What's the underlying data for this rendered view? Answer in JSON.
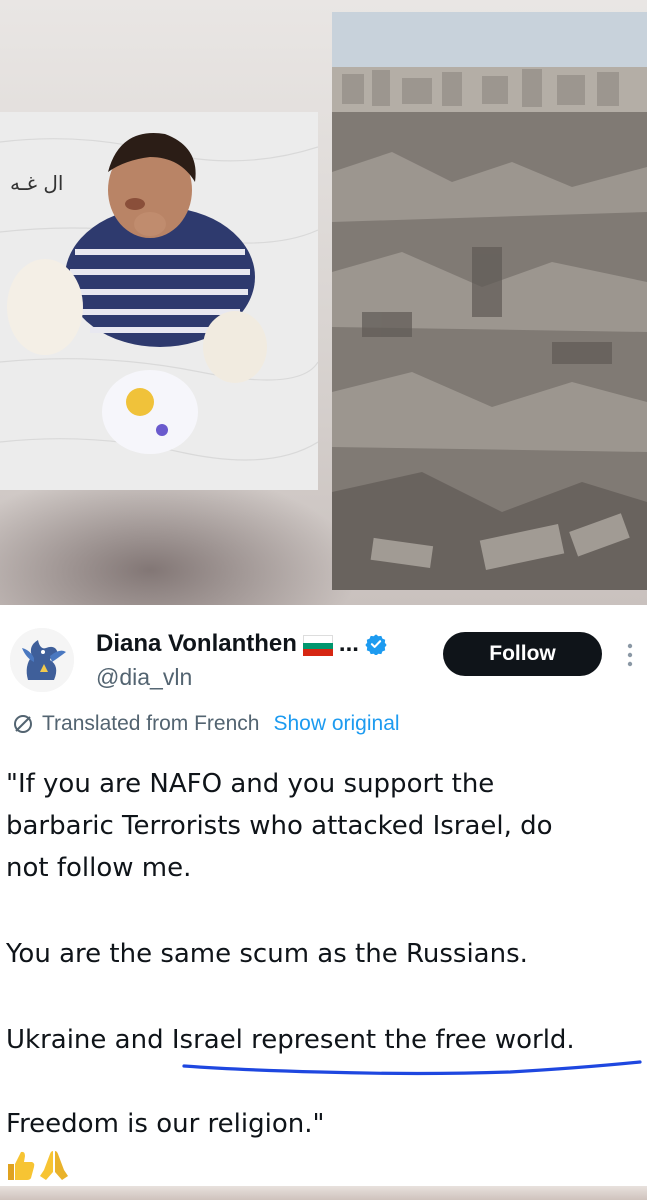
{
  "images": {
    "left_photo": "child-patient-photo",
    "right_photo": "rubble-landscape-photo",
    "left_photo_caption": "ال غـه"
  },
  "tweet": {
    "display_name": "Diana Vonlanthen",
    "name_suffix": "...",
    "handle": "@dia_vln",
    "follow_label": "Follow",
    "translated_label": "Translated from French",
    "show_original_label": "Show original",
    "body_lines": [
      "\"If you are NAFO and you support the",
      "barbaric Terrorists who attacked Israel, do",
      "not follow me.",
      "You are the same scum as the Russians.",
      "Ukraine and Israel represent the free world.",
      "Freedom is our religion.\""
    ],
    "emojis": [
      "thumbs-up-icon",
      "folded-hands-icon"
    ]
  },
  "colors": {
    "follow_bg": "#0f1419",
    "link": "#1d9bf0",
    "secondary_text": "#536471",
    "verified": "#1d9bf0",
    "underline": "#1e47e0",
    "flag": [
      "#ffffff",
      "#00966e",
      "#d62612"
    ]
  }
}
